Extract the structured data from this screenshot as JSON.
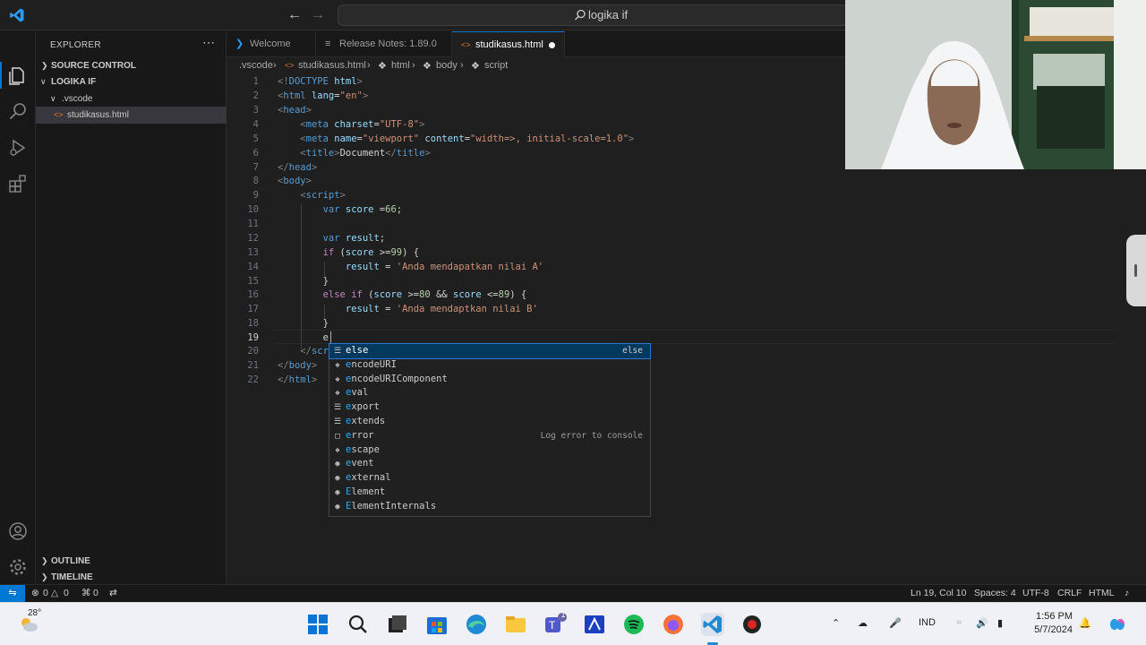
{
  "titlebar": {
    "search_text": "logika if",
    "back_icon": "arrow-left-icon",
    "forward_icon": "arrow-right-icon"
  },
  "explorer": {
    "title": "EXPLORER",
    "source_control": "SOURCE CONTROL",
    "folder": "LOGIKA IF",
    "subfolder": ".vscode",
    "file": "studikasus.html",
    "outline": "OUTLINE",
    "timeline": "TIMELINE"
  },
  "tabs": [
    {
      "label": "Welcome",
      "icon": "vscode-icon"
    },
    {
      "label": "Release Notes: 1.89.0",
      "icon": "file-icon"
    },
    {
      "label": "studikasus.html",
      "icon": "html-icon",
      "modified": true
    }
  ],
  "breadcrumbs": [
    ".vscode",
    "studikasus.html",
    "html",
    "body",
    "script"
  ],
  "editor": {
    "line_numbers": [
      "1",
      "2",
      "3",
      "4",
      "5",
      "6",
      "7",
      "8",
      "9",
      "10",
      "11",
      "12",
      "13",
      "14",
      "15",
      "16",
      "17",
      "18",
      "19",
      "20",
      "21",
      "22"
    ],
    "current_line": 19
  },
  "suggest": {
    "items": [
      {
        "label": "else",
        "icon": "snippet-icon",
        "detail": "else"
      },
      {
        "label": "encodeURI",
        "icon": "method-icon",
        "detail": ""
      },
      {
        "label": "encodeURIComponent",
        "icon": "method-icon",
        "detail": ""
      },
      {
        "label": "eval",
        "icon": "method-icon",
        "detail": ""
      },
      {
        "label": "export",
        "icon": "keyword-icon",
        "detail": ""
      },
      {
        "label": "extends",
        "icon": "keyword-icon",
        "detail": ""
      },
      {
        "label": "error",
        "icon": "snippet-box-icon",
        "detail": "Log error to console"
      },
      {
        "label": "escape",
        "icon": "method-icon",
        "detail": ""
      },
      {
        "label": "event",
        "icon": "variable-icon",
        "detail": ""
      },
      {
        "label": "external",
        "icon": "variable-icon",
        "detail": ""
      },
      {
        "label": "Element",
        "icon": "variable-icon",
        "detail": ""
      },
      {
        "label": "ElementInternals",
        "icon": "variable-icon",
        "detail": ""
      }
    ]
  },
  "status": {
    "errors": "0",
    "warnings": "0",
    "ports": "0",
    "position": "Ln 19, Col 10",
    "spaces": "Spaces: 4",
    "encoding": "UTF-8",
    "eol": "CRLF",
    "language": "HTML"
  },
  "taskbar": {
    "temperature": "28°",
    "language": "IND",
    "time": "1:56 PM",
    "date": "5/7/2024",
    "teams_badge": "1"
  },
  "colors": {
    "accent": "#0078d4",
    "editor_bg": "#1f1f1f",
    "sidebar_bg": "#181818"
  }
}
